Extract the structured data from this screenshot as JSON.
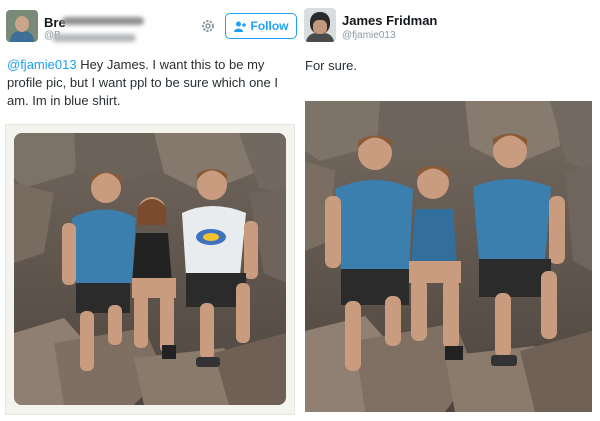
{
  "left_tweet": {
    "name": "Bre",
    "handle": "@B",
    "follow_label": "Follow",
    "text_mention": "@fjamie013",
    "text_body": " Hey James. I want this to be my profile pic, but I want ppl to be sure which one I am. Im in blue shirt.",
    "follow_icon": "add-user-icon",
    "settings_icon": "gear-icon"
  },
  "right_tweet": {
    "name": "James Fridman",
    "handle": "@fjamie013",
    "text": "For sure."
  },
  "colors": {
    "accent": "#1da1f2",
    "text": "#292f33",
    "muted": "#8899a6",
    "blue_shirt": "#3a7fae",
    "rock": "#7b6a5d"
  }
}
